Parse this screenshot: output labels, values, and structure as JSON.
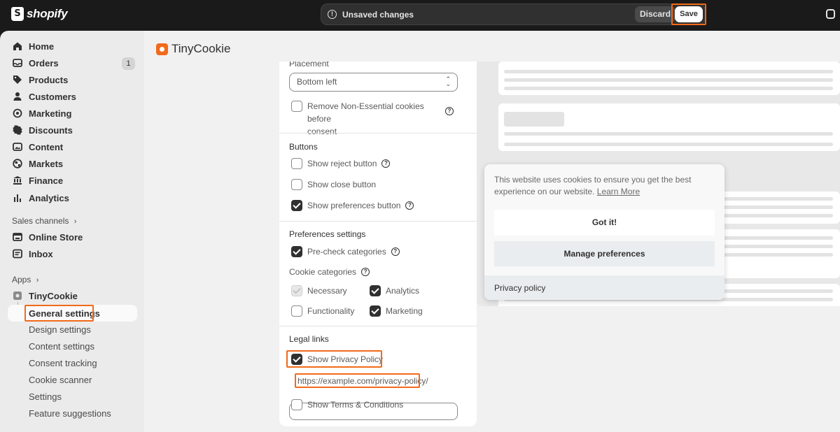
{
  "topbar": {
    "brand": "shopify",
    "unsaved_text": "Unsaved changes",
    "discard_label": "Discard",
    "save_label": "Save"
  },
  "sidebar": {
    "items": [
      {
        "label": "Home",
        "icon": "home-icon"
      },
      {
        "label": "Orders",
        "icon": "orders-icon",
        "badge": "1"
      },
      {
        "label": "Products",
        "icon": "tag-icon"
      },
      {
        "label": "Customers",
        "icon": "person-icon"
      },
      {
        "label": "Marketing",
        "icon": "target-icon"
      },
      {
        "label": "Discounts",
        "icon": "discount-icon"
      },
      {
        "label": "Content",
        "icon": "content-icon"
      },
      {
        "label": "Markets",
        "icon": "globe-icon"
      },
      {
        "label": "Finance",
        "icon": "bank-icon"
      },
      {
        "label": "Analytics",
        "icon": "bar-chart-icon"
      }
    ],
    "sales_channels_label": "Sales channels",
    "sales_channels": [
      {
        "label": "Online Store",
        "icon": "store-icon"
      },
      {
        "label": "Inbox",
        "icon": "inbox-icon"
      }
    ],
    "apps_label": "Apps",
    "app_name": "TinyCookie",
    "app_subitems": [
      "General settings",
      "Design settings",
      "Content settings",
      "Consent tracking",
      "Cookie scanner",
      "Settings",
      "Feature suggestions"
    ]
  },
  "main": {
    "app_title": "TinyCookie",
    "settings": {
      "placement_label": "Placement",
      "placement_value": "Bottom left",
      "remove_nonessential_line1": "Remove Non-Essential cookies before",
      "remove_nonessential_line2": "consent",
      "buttons_title": "Buttons",
      "show_reject": "Show reject button",
      "show_close": "Show close button",
      "show_preferences": "Show preferences button",
      "preferences_title": "Preferences settings",
      "precheck": "Pre-check categories",
      "cookie_categories": "Cookie categories",
      "cat_necessary": "Necessary",
      "cat_analytics": "Analytics",
      "cat_functionality": "Functionality",
      "cat_marketing": "Marketing",
      "legal_title": "Legal links",
      "show_privacy": "Show Privacy Policy",
      "privacy_url": "https://example.com/privacy-policy/",
      "show_terms": "Show Terms & Conditions"
    },
    "preview": {
      "message": "This website uses cookies to ensure you get the best experience on our website.",
      "learn_more": "Learn More",
      "got_it": "Got it!",
      "manage": "Manage preferences",
      "privacy_policy": "Privacy policy"
    }
  },
  "colors": {
    "accent_highlight": "#f26a1b",
    "topbar_bg": "#1a1a1a",
    "sidebar_bg": "#ebebeb"
  }
}
